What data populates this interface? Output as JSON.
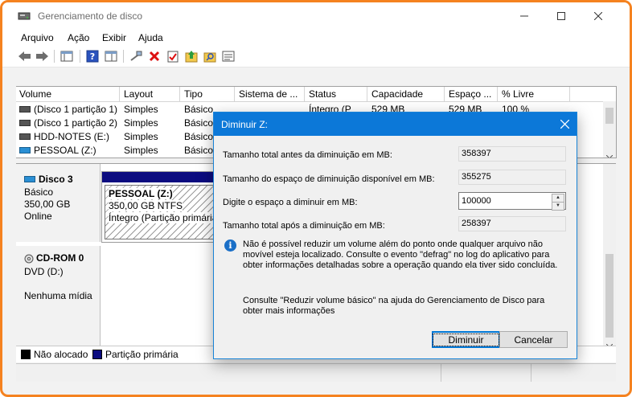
{
  "window": {
    "title": "Gerenciamento de disco"
  },
  "menu": [
    "Arquivo",
    "Ação",
    "Exibir",
    "Ajuda"
  ],
  "columns": [
    "Volume",
    "Layout",
    "Tipo",
    "Sistema de ...",
    "Status",
    "Capacidade",
    "Espaço ...",
    "% Livre"
  ],
  "volumes": [
    {
      "name": "(Disco 1 partição 1)",
      "layout": "Simples",
      "type": "Básico",
      "status": "Íntegro (P",
      "capacity": "529 MB",
      "free": "529 MB",
      "pct": "100 %"
    },
    {
      "name": "(Disco 1 partição 2)",
      "layout": "Simples",
      "type": "Básico"
    },
    {
      "name": "HDD-NOTES (E:)",
      "layout": "Simples",
      "type": "Básico"
    },
    {
      "name": "PESSOAL (Z:)",
      "layout": "Simples",
      "type": "Básico"
    }
  ],
  "disks": [
    {
      "name": "Disco 3",
      "kind": "Básico",
      "size": "350,00 GB",
      "state": "Online",
      "partition": {
        "name": "PESSOAL  (Z:)",
        "size": "350,00 GB NTFS",
        "status": "Íntegro (Partição primária"
      }
    },
    {
      "name": "CD-ROM 0",
      "kind": "DVD (D:)",
      "state": "Nenhuma mídia"
    }
  ],
  "legend": [
    {
      "label": "Não alocado",
      "color": "#000000"
    },
    {
      "label": "Partição primária",
      "color": "#0c0c80"
    }
  ],
  "dialog": {
    "title": "Diminuir Z:",
    "total_before_label": "Tamanho total antes da diminuição em MB:",
    "total_before_value": "358397",
    "available_label": "Tamanho do espaço de diminuição disponível em MB:",
    "available_value": "355275",
    "shrink_label": "Digite o espaço a diminuir em MB:",
    "shrink_value": "100000",
    "total_after_label": "Tamanho total após a diminuição em MB:",
    "total_after_value": "258397",
    "info": "Não é possível reduzir um volume além do ponto onde qualquer arquivo não movível esteja localizado. Consulte o evento \"defrag\" no log do aplicativo para obter informações detalhadas sobre a operação quando ela tiver sido concluída.",
    "help": "Consulte \"Reduzir volume básico\" na ajuda do Gerenciamento de Disco para obter mais informações",
    "ok_label": "Diminuir",
    "cancel_label": "Cancelar"
  },
  "colors": {
    "accent": "#0c78d8",
    "frame": "#f5821f",
    "primary_partition": "#0c0c80"
  }
}
